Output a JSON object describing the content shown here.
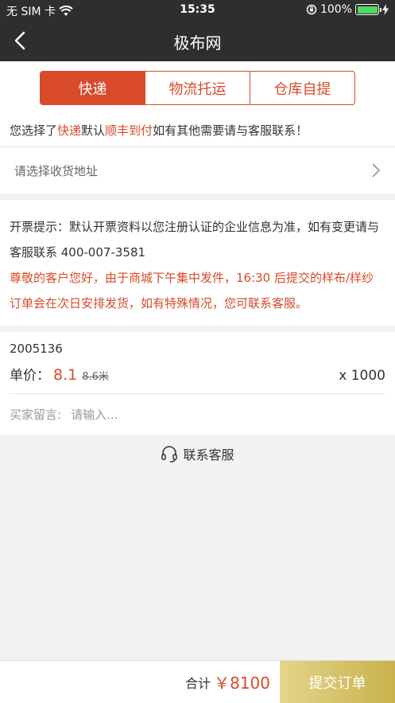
{
  "statusbar": {
    "carrier": "无 SIM 卡",
    "time": "15:35",
    "battery": "100%",
    "battery_level": 1.0
  },
  "nav": {
    "title": "极布网"
  },
  "tabs": [
    {
      "label": "快递"
    },
    {
      "label": "物流托运"
    },
    {
      "label": "仓库自提"
    }
  ],
  "notice": {
    "prefix": "您选择了",
    "method": "快递",
    "middle": "默认",
    "carrier": "顺丰到付",
    "suffix": "如有其他需要请与客服联系！"
  },
  "address": {
    "placeholder": "请选择收货地址"
  },
  "invoice": {
    "tip": "开票提示：默认开票资料以您注册认证的企业信息为准，如有变更请与客服联系 400-007-3581",
    "warning": "尊敬的客户您好，由于商城下午集中发件，16:30 后提交的样布/样纱订单会在次日安排发货，如有特殊情况，您可联系客服。"
  },
  "product": {
    "id": "2005136",
    "price_label": "单价：",
    "price": "8.1",
    "original_price": "8.6米",
    "quantity": "x 1000"
  },
  "message": {
    "label": "买家留言:",
    "placeholder": "请输入..."
  },
  "service": {
    "label": "联系客服"
  },
  "footer": {
    "total_label": "合计",
    "total_amount": "￥8100",
    "submit_label": "提交订单"
  },
  "colors": {
    "accent": "#d84a2a",
    "header": "#2e2e2e",
    "submit_start": "#e3d58a",
    "submit_end": "#c9b24c"
  }
}
